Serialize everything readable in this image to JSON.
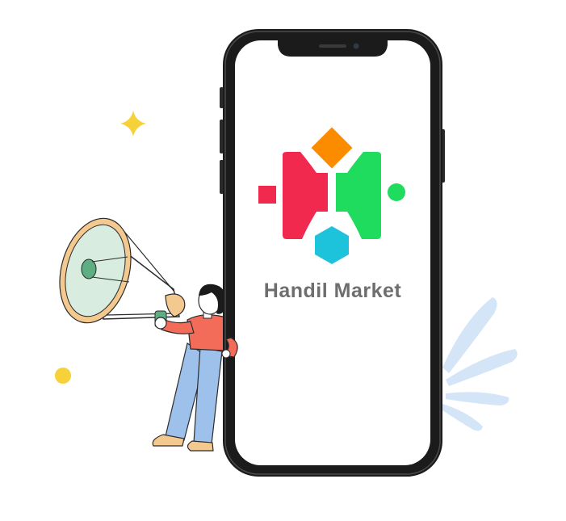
{
  "app": {
    "brand_name": "Handil Market"
  },
  "colors": {
    "logo_red": "#f1294f",
    "logo_green": "#1fdc5f",
    "logo_orange": "#fb8c00",
    "logo_cyan": "#1cc3da",
    "phone_frame": "#1b1b1b",
    "screen": "#ffffff",
    "brand_text": "#6e6e6e",
    "megaphone_fill": "#d8ecdf",
    "megaphone_rim": "#f4c98f",
    "shirt": "#f36c5a",
    "pants": "#9ec1ec",
    "splash": "#cfe1f6",
    "sparkle": "#f6d13a"
  },
  "icons": {
    "logo": "handil-market-logo-icon",
    "megaphone": "megaphone-icon",
    "sparkle": "sparkle-icon",
    "dot": "dot-icon",
    "splash": "splash-icon"
  }
}
